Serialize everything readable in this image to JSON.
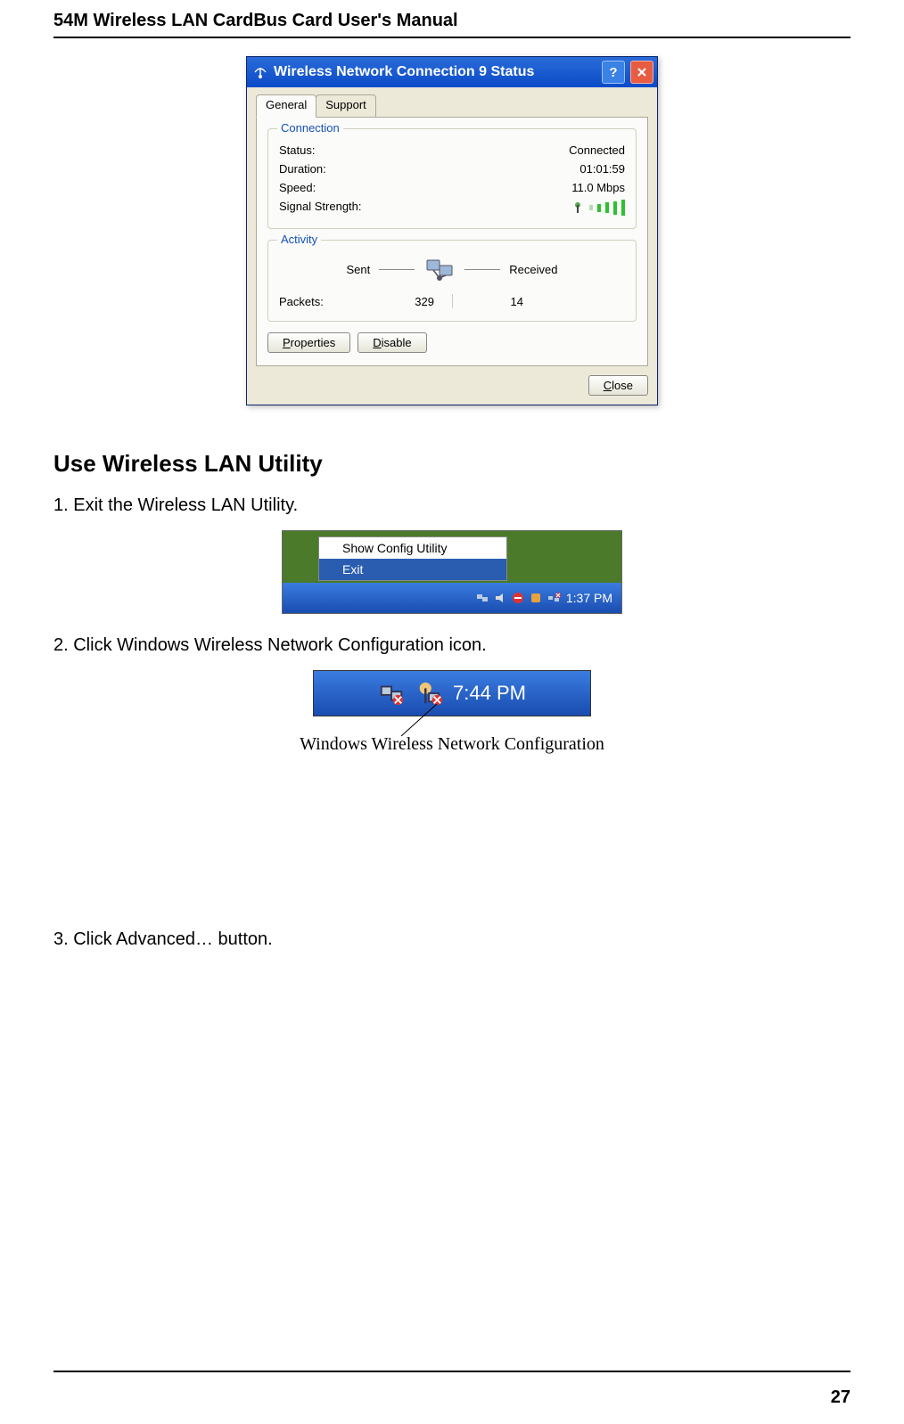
{
  "doc": {
    "header_title": "54M Wireless LAN CardBus Card User's Manual",
    "page_number": "27"
  },
  "dialog": {
    "title": "Wireless Network Connection 9 Status",
    "tabs": {
      "general": "General",
      "support": "Support"
    },
    "connection": {
      "legend": "Connection",
      "status_label": "Status:",
      "status_value": "Connected",
      "duration_label": "Duration:",
      "duration_value": "01:01:59",
      "speed_label": "Speed:",
      "speed_value": "11.0 Mbps",
      "signal_label": "Signal Strength:"
    },
    "activity": {
      "legend": "Activity",
      "sent": "Sent",
      "received": "Received",
      "packets_label": "Packets:",
      "packets_sent": "329",
      "packets_received": "14"
    },
    "buttons": {
      "properties": "Properties",
      "disable": "Disable",
      "close": "Close"
    }
  },
  "section": {
    "heading": "Use Wireless LAN Utility",
    "step1": "1.  Exit the Wireless LAN Utility.",
    "step2": "2.  Click Windows Wireless Network Configuration icon.",
    "step3": "3.  Click Advanced… button.",
    "caption": "Windows Wireless Network Configuration"
  },
  "tray1": {
    "item1": "Show Config Utility",
    "item2": "Exit",
    "time": "1:37 PM"
  },
  "tray2": {
    "time": "7:44 PM"
  }
}
